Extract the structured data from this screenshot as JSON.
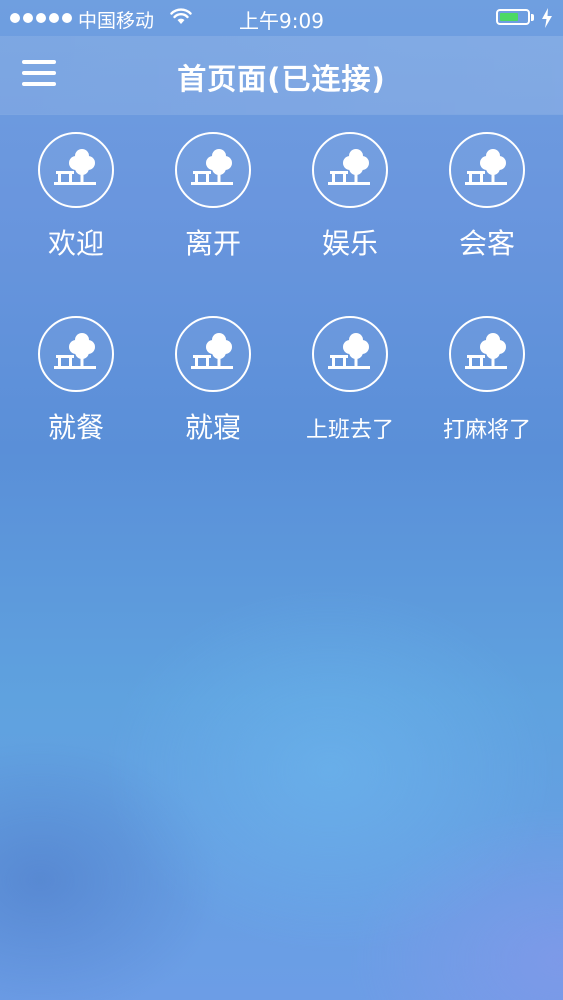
{
  "status_bar": {
    "carrier": "中国移动",
    "time": "上午9:09",
    "battery_level": 0.7,
    "battery_color": "#4cd964"
  },
  "nav": {
    "title": "首页面(已连接)"
  },
  "icons": {
    "tile": "tree-bench-icon",
    "menu": "hamburger-menu-icon",
    "wifi": "wifi-icon",
    "charge": "charging-bolt-icon"
  },
  "tiles": [
    {
      "label": "欢迎"
    },
    {
      "label": "离开"
    },
    {
      "label": "娱乐"
    },
    {
      "label": "会客"
    },
    {
      "label": "就餐"
    },
    {
      "label": "就寝"
    },
    {
      "label": "上班去了"
    },
    {
      "label": "打麻将了"
    }
  ]
}
